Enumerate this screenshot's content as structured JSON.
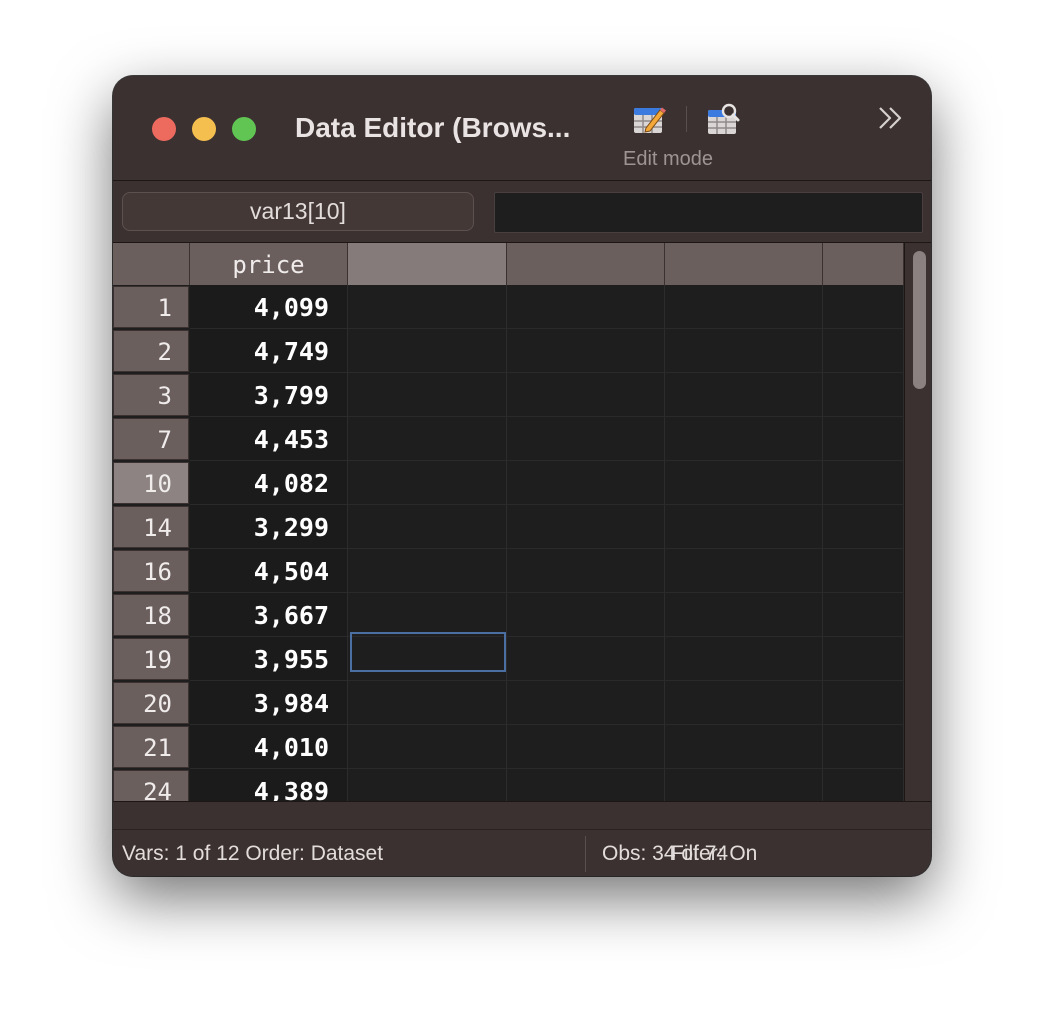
{
  "window": {
    "title": "Data Editor (Brows...",
    "traffic_lights": [
      "close",
      "minimize",
      "zoom"
    ]
  },
  "toolbar": {
    "edit_icon": "table-pencil-icon",
    "browse_icon": "table-magnifier-icon",
    "mode_label": "Edit mode",
    "overflow_icon": "double-chevron-right-icon"
  },
  "cellbar": {
    "cell_name": "var13[10]",
    "cell_value": ""
  },
  "grid": {
    "columns": [
      "price",
      "",
      "",
      "",
      ""
    ],
    "rows": [
      {
        "obs": "1",
        "price": "4,099"
      },
      {
        "obs": "2",
        "price": "4,749"
      },
      {
        "obs": "3",
        "price": "3,799"
      },
      {
        "obs": "7",
        "price": "4,453"
      },
      {
        "obs": "10",
        "price": "4,082"
      },
      {
        "obs": "14",
        "price": "3,299"
      },
      {
        "obs": "16",
        "price": "4,504"
      },
      {
        "obs": "18",
        "price": "3,667"
      },
      {
        "obs": "19",
        "price": "3,955"
      },
      {
        "obs": "20",
        "price": "3,984"
      },
      {
        "obs": "21",
        "price": "4,010"
      },
      {
        "obs": "24",
        "price": "4,389"
      }
    ],
    "selected_row_obs": "10"
  },
  "status": {
    "left": "Vars: 1 of 12  Order: Dataset",
    "obs": "Obs: 34 of 74",
    "filter": "Filter: On"
  },
  "colors": {
    "window_bg": "#3b3130",
    "grid_bg": "#1e1e1e",
    "header_bg": "#6b5f5e",
    "selection_border": "#4c6fa3"
  }
}
